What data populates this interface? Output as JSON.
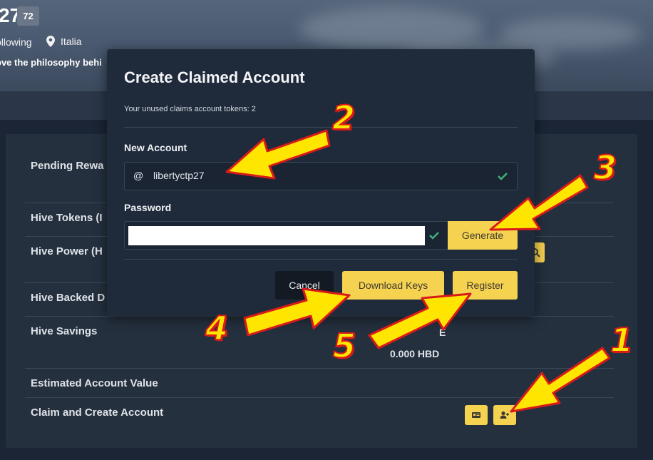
{
  "profile": {
    "rep_number": "27",
    "rep_badge": "72",
    "following": "ollowing",
    "location": "Italia",
    "about": "ove the philosophy behi"
  },
  "wallet": {
    "rows": [
      {
        "label": "Pending Rewa"
      },
      {
        "label": "Hive Tokens (I"
      },
      {
        "label": "Hive Power (H"
      },
      {
        "label": "Hive Backed D"
      },
      {
        "label": "Hive Savings"
      },
      {
        "label": "Estimated Account Value"
      },
      {
        "label": "Claim and Create Account"
      }
    ],
    "savings_hive": "E",
    "savings_hbd": "0.000 HBD",
    "savings_hive_partial": "HIVE"
  },
  "modal": {
    "title": "Create Claimed Account",
    "tokens_text": "Your unused claims account tokens: 2",
    "new_account_label": "New Account",
    "at_symbol": "@",
    "account_value": "libertyctp27",
    "password_label": "Password",
    "password_value": "",
    "generate_label": "Generate",
    "cancel_label": "Cancel",
    "download_label": "Download Keys",
    "register_label": "Register"
  },
  "annotations": [
    "1",
    "2",
    "3",
    "4",
    "5"
  ],
  "colors": {
    "accent": "#f6d251",
    "check": "#3fb37f",
    "arrow_fill": "#ffe600",
    "arrow_stroke": "#d81a1a"
  }
}
